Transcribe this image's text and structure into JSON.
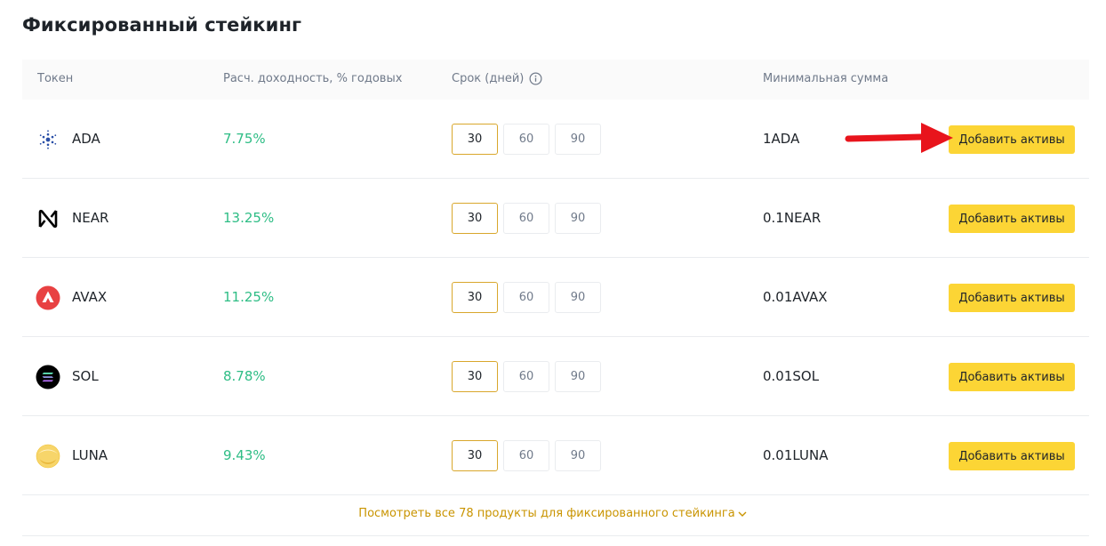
{
  "title": "Фиксированный стейкинг",
  "headers": {
    "token": "Токен",
    "yield": "Расч. доходность, % годовых",
    "term": "Срок (дней)",
    "min": "Минимальная сумма"
  },
  "rows": [
    {
      "token": "ADA",
      "icon": "cardano-icon",
      "yield": "7.75%",
      "terms": [
        "30",
        "60",
        "90"
      ],
      "active": 0,
      "min": "1ADA",
      "button": "Добавить активы"
    },
    {
      "token": "NEAR",
      "icon": "near-icon",
      "yield": "13.25%",
      "terms": [
        "30",
        "60",
        "90"
      ],
      "active": 0,
      "min": "0.1NEAR",
      "button": "Добавить активы"
    },
    {
      "token": "AVAX",
      "icon": "avalanche-icon",
      "yield": "11.25%",
      "terms": [
        "30",
        "60",
        "90"
      ],
      "active": 0,
      "min": "0.01AVAX",
      "button": "Добавить активы"
    },
    {
      "token": "SOL",
      "icon": "solana-icon",
      "yield": "8.78%",
      "terms": [
        "30",
        "60",
        "90"
      ],
      "active": 0,
      "min": "0.01SOL",
      "button": "Добавить активы"
    },
    {
      "token": "LUNA",
      "icon": "terra-luna-icon",
      "yield": "9.43%",
      "terms": [
        "30",
        "60",
        "90"
      ],
      "active": 0,
      "min": "0.01LUNA",
      "button": "Добавить активы"
    }
  ],
  "footer": {
    "link": "Посмотреть все 78 продукты для фиксированного стейкинга"
  },
  "colors": {
    "accent": "#fcd535",
    "positive": "#2ebd85",
    "link": "#c99400",
    "annotation_arrow": "#e8141c"
  }
}
